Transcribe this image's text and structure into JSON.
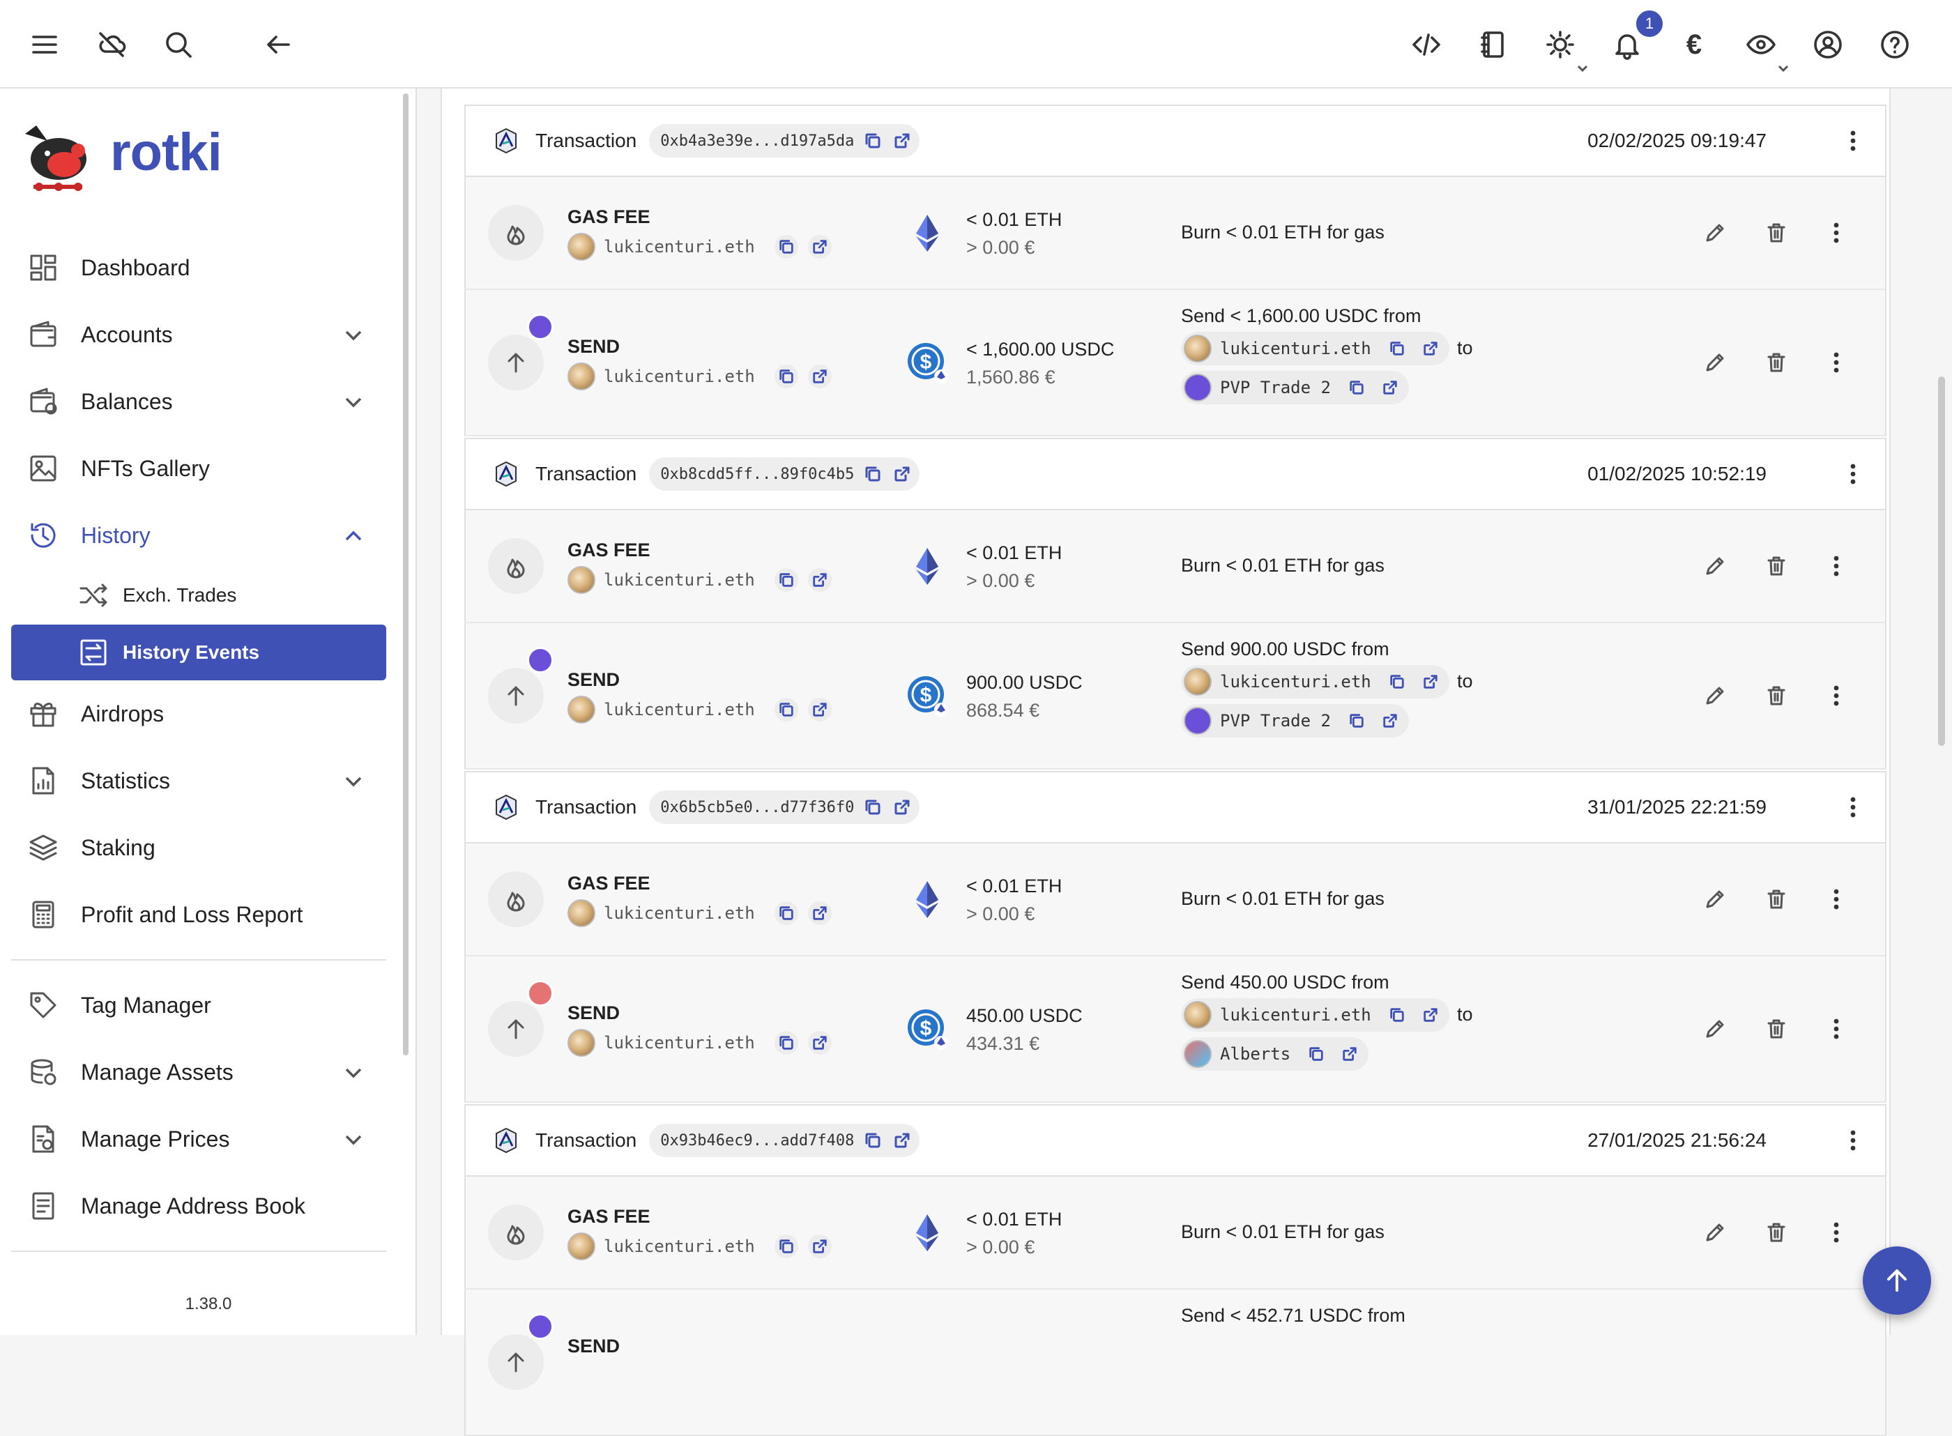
{
  "app": {
    "name": "rotki",
    "version": "1.38.0"
  },
  "topbar": {
    "notification_count": "1",
    "currency_symbol": "€"
  },
  "sidebar": {
    "items": [
      {
        "label": "Dashboard",
        "icon": "dashboard-icon"
      },
      {
        "label": "Accounts",
        "icon": "wallet-icon"
      },
      {
        "label": "Balances",
        "icon": "balances-icon"
      },
      {
        "label": "NFTs Gallery",
        "icon": "image-icon"
      },
      {
        "label": "History",
        "icon": "history-icon"
      },
      {
        "label": "Airdrops",
        "icon": "gift-icon"
      },
      {
        "label": "Statistics",
        "icon": "statistics-icon"
      },
      {
        "label": "Staking",
        "icon": "layers-icon"
      },
      {
        "label": "Profit and Loss Report",
        "icon": "calculator-icon"
      },
      {
        "label": "Tag Manager",
        "icon": "tag-icon"
      },
      {
        "label": "Manage Assets",
        "icon": "database-icon"
      },
      {
        "label": "Manage Prices",
        "icon": "prices-icon"
      },
      {
        "label": "Manage Address Book",
        "icon": "address-book-icon"
      }
    ],
    "history_sub": [
      {
        "label": "Exch. Trades",
        "icon": "shuffle-icon"
      },
      {
        "label": "History Events",
        "icon": "swap-icon",
        "selected": true
      }
    ]
  },
  "transactions": [
    {
      "label": "Transaction",
      "hash": "0xb4a3e39e...d197a5da",
      "date": "02/02/2025 09:19:47",
      "events": [
        {
          "type": "GAS FEE",
          "account": "lukicenturi.eth",
          "amount": "< 0.01 ETH",
          "fiat": "> 0.00 €",
          "note": "Burn < 0.01 ETH for gas"
        },
        {
          "type": "SEND",
          "account": "lukicenturi.eth",
          "amount": "< 1,600.00 USDC",
          "fiat": "1,560.86 €",
          "note": "Send < 1,600.00 USDC from",
          "from": "lukicenturi.eth",
          "to_word": "to",
          "to": "PVP Trade 2"
        }
      ]
    },
    {
      "label": "Transaction",
      "hash": "0xb8cdd5ff...89f0c4b5",
      "date": "01/02/2025 10:52:19",
      "events": [
        {
          "type": "GAS FEE",
          "account": "lukicenturi.eth",
          "amount": "< 0.01 ETH",
          "fiat": "> 0.00 €",
          "note": "Burn < 0.01 ETH for gas"
        },
        {
          "type": "SEND",
          "account": "lukicenturi.eth",
          "amount": "900.00 USDC",
          "fiat": "868.54 €",
          "note": "Send 900.00 USDC from",
          "from": "lukicenturi.eth",
          "to_word": "to",
          "to": "PVP Trade 2"
        }
      ]
    },
    {
      "label": "Transaction",
      "hash": "0x6b5cb5e0...d77f36f0",
      "date": "31/01/2025 22:21:59",
      "events": [
        {
          "type": "GAS FEE",
          "account": "lukicenturi.eth",
          "amount": "< 0.01 ETH",
          "fiat": "> 0.00 €",
          "note": "Burn < 0.01 ETH for gas"
        },
        {
          "type": "SEND",
          "account": "lukicenturi.eth",
          "amount": "450.00 USDC",
          "fiat": "434.31 €",
          "note": "Send 450.00 USDC from",
          "from": "lukicenturi.eth",
          "to_word": "to",
          "to": "Alberts"
        }
      ]
    },
    {
      "label": "Transaction",
      "hash": "0x93b46ec9...add7f408",
      "date": "27/01/2025 21:56:24",
      "events": [
        {
          "type": "GAS FEE",
          "account": "lukicenturi.eth",
          "amount": "< 0.01 ETH",
          "fiat": "> 0.00 €",
          "note": "Burn < 0.01 ETH for gas"
        },
        {
          "type": "SEND",
          "note": "Send < 452.71 USDC from"
        }
      ]
    }
  ],
  "colors": {
    "primary": "#3f51b5",
    "usdc": "#2775ca",
    "eth": "#627eea"
  }
}
